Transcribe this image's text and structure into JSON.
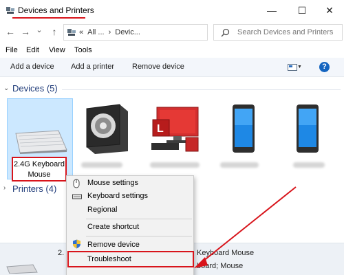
{
  "window": {
    "title": "Devices and Printers",
    "minimize_glyph": "—",
    "maximize_glyph": "☐",
    "close_glyph": "✕"
  },
  "nav": {
    "back_glyph": "←",
    "forward_glyph": "→",
    "dropdown_glyph": "⌄",
    "up_glyph": "↑",
    "address_parts": [
      "«",
      "All ...",
      "›",
      "Devic..."
    ],
    "address_dropdown_glyph": "⌄",
    "refresh_glyph": "↻",
    "search_placeholder": "Search Devices and Printers"
  },
  "menu": [
    "File",
    "Edit",
    "View",
    "Tools"
  ],
  "toolbar": {
    "add_device": "Add a device",
    "add_printer": "Add a printer",
    "remove_device": "Remove device",
    "view_caret": "▼",
    "help": "?"
  },
  "sections": {
    "devices": {
      "chevron": "⌄",
      "label": "Devices (5)"
    },
    "printers": {
      "chevron": "›",
      "label": "Printers (4)"
    }
  },
  "devices": [
    {
      "label": "2.4G Keyboard Mouse",
      "icon": "keyboard-icon",
      "selected": true
    },
    {
      "label": "",
      "icon": "speaker-icon",
      "selected": false
    },
    {
      "label": "",
      "icon": "computer-icon",
      "selected": false
    },
    {
      "label": "",
      "icon": "phone-icon",
      "selected": false
    },
    {
      "label": "",
      "icon": "phone-icon",
      "selected": false
    }
  ],
  "details": {
    "line1_prefix": "2.",
    "line1_name": "Keyboard Mouse",
    "line2": "board; Mouse"
  },
  "context_menu": {
    "items": [
      {
        "label": "Mouse settings",
        "icon": "mouse-icon"
      },
      {
        "label": "Keyboard settings",
        "icon": "keyboard-icon"
      },
      {
        "label": "Regional",
        "icon": ""
      },
      {
        "label": "Create shortcut",
        "icon": ""
      },
      {
        "label": "Remove device",
        "icon": "shield-icon"
      },
      {
        "label": "Troubleshoot",
        "icon": ""
      }
    ]
  },
  "colors": {
    "accent_red": "#d8141b",
    "selection": "#cce8ff",
    "section_label": "#1e3a78"
  }
}
